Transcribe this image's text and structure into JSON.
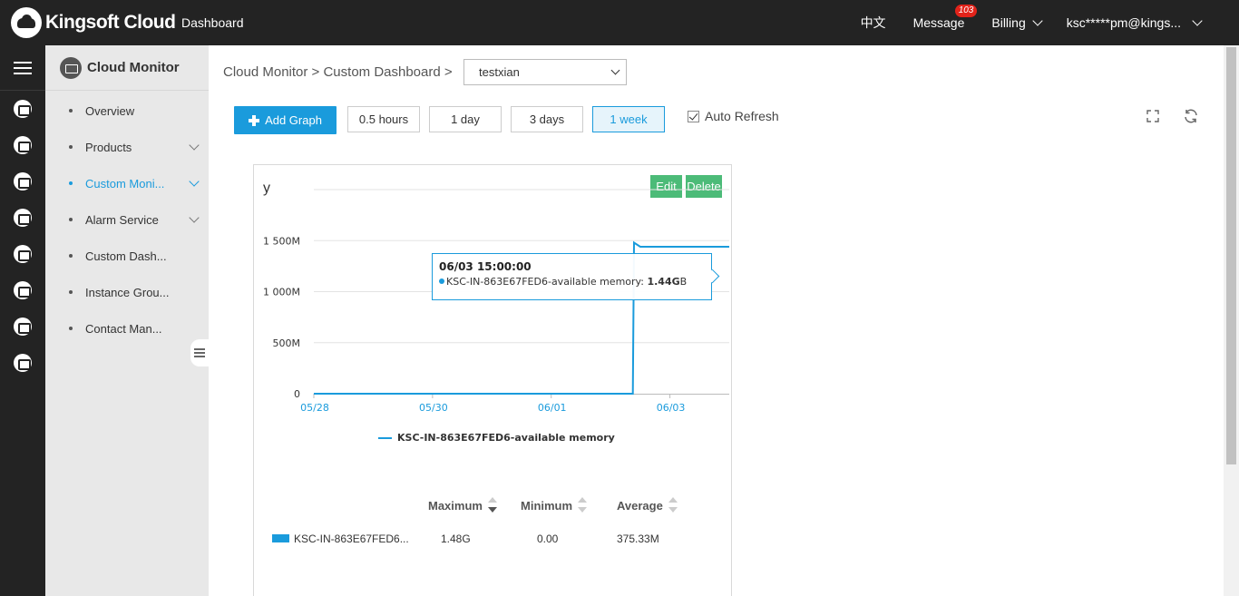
{
  "topbar": {
    "brand": "Kingsoft Cloud",
    "nav_dashboard": "Dashboard",
    "language": "中文",
    "message": "Message",
    "message_count": "103",
    "billing": "Billing",
    "user": "ksc*****pm@kings..."
  },
  "sidebar": {
    "title": "Cloud Monitor",
    "items": [
      {
        "label": "Overview"
      },
      {
        "label": "Products"
      },
      {
        "label": "Custom Moni..."
      },
      {
        "label": "Alarm Service"
      },
      {
        "label": "Custom Dash..."
      },
      {
        "label": "Instance Grou..."
      },
      {
        "label": "Contact Man..."
      }
    ]
  },
  "breadcrumb": {
    "text": "Cloud Monitor > Custom Dashboard >"
  },
  "dashboard_select": {
    "value": "testxian"
  },
  "toolbar": {
    "add_graph": "Add Graph",
    "ranges": [
      "0.5 hours",
      "1 day",
      "3 days",
      "1 week"
    ],
    "selected_range": "1 week",
    "auto_refresh": "Auto Refresh",
    "auto_refresh_checked": true
  },
  "graph": {
    "title": "y",
    "edit": "Edit",
    "delete": "Delete",
    "tooltip_time": "06/03 15:00:00",
    "tooltip_series": "KSC-IN-863E67FED6-available memory:",
    "tooltip_value": "1.44G",
    "tooltip_unit_tail": "B",
    "legend": "KSC-IN-863E67FED6-available memory",
    "stats_headers": {
      "max": "Maximum",
      "min": "Minimum",
      "avg": "Average"
    },
    "stats_row": {
      "series": "KSC-IN-863E67FED6...",
      "max": "1.48G",
      "min": "0.00",
      "avg": "375.33M"
    }
  },
  "chart_data": {
    "type": "line",
    "title": "y",
    "xlabel": "",
    "ylabel": "",
    "x_ticks": [
      "05/28",
      "05/30",
      "06/01",
      "06/03"
    ],
    "y_ticks": [
      "0",
      "500M",
      "1 000M",
      "1 500M"
    ],
    "ylim": [
      0,
      2000
    ],
    "y_unit": "M",
    "grid": true,
    "legend_position": "bottom",
    "color": "#1a9bdc",
    "series": [
      {
        "name": "KSC-IN-863E67FED6-available memory",
        "points": [
          {
            "x": "05/28 00:00",
            "y": 0
          },
          {
            "x": "06/02 09:00",
            "y": 0
          },
          {
            "x": "06/02 09:30",
            "y": 1480
          },
          {
            "x": "06/02 12:00",
            "y": 1440
          },
          {
            "x": "06/03 15:00",
            "y": 1440
          },
          {
            "x": "06/04 00:00",
            "y": 1440
          }
        ]
      }
    ]
  },
  "colors": {
    "accent": "#1a9bdc",
    "edit_delete": "#4cbb78",
    "topbar": "#232323",
    "badge": "#e2231a"
  }
}
